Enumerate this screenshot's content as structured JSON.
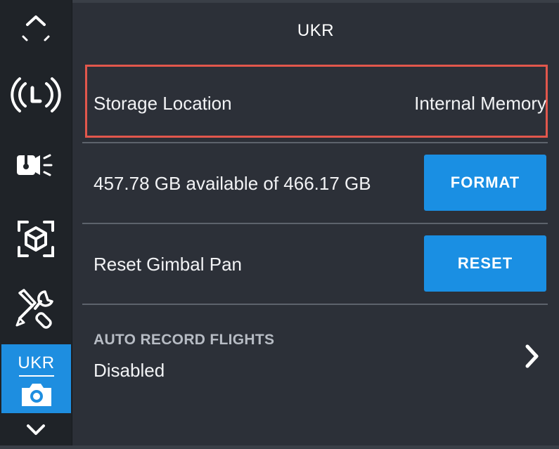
{
  "header": {
    "title": "UKR"
  },
  "sidebar": {
    "items": [
      {
        "icon": "chevron-up-icon"
      },
      {
        "icon": "flight-mode-l-icon"
      },
      {
        "icon": "gimbal-light-icon"
      },
      {
        "icon": "object-tracking-icon"
      },
      {
        "icon": "tools-icon"
      },
      {
        "label": "UKR",
        "icon": "camera-icon",
        "active": true
      },
      {
        "icon": "chevron-down-icon"
      }
    ]
  },
  "storage": {
    "label": "Storage Location",
    "value": "Internal Memory"
  },
  "capacity": {
    "text": "457.78 GB available of 466.17 GB",
    "button_label": "FORMAT"
  },
  "gimbal": {
    "label": "Reset Gimbal Pan",
    "button_label": "RESET"
  },
  "auto_record": {
    "label": "AUTO RECORD FLIGHTS",
    "value": "Disabled"
  },
  "colors": {
    "accent": "#1a8fe3",
    "highlight": "#e2574c",
    "background": "#2c3038",
    "sidebar": "#1f2328"
  }
}
